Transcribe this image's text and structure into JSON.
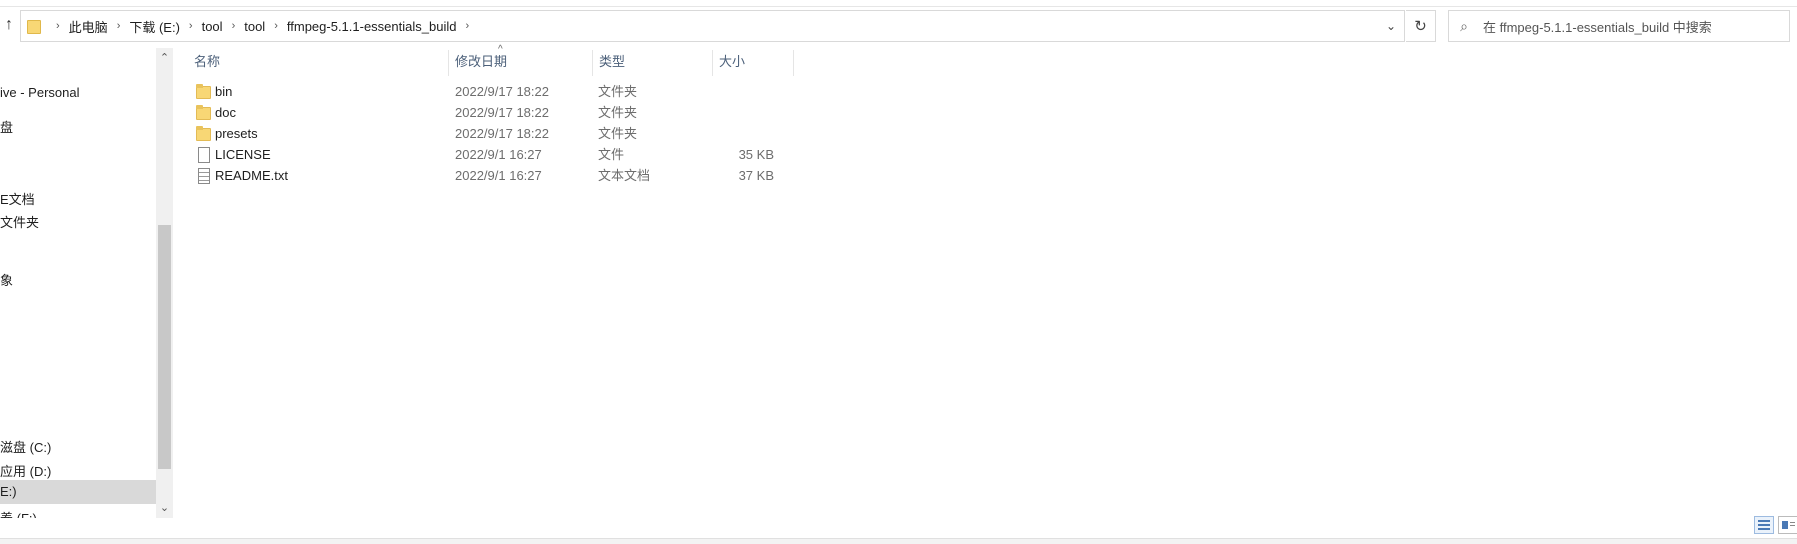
{
  "address_bar": {
    "breadcrumbs": [
      "此电脑",
      "下载 (E:)",
      "tool",
      "tool",
      "ffmpeg-5.1.1-essentials_build"
    ],
    "up_icon": "↑",
    "dropdown_icon": "⌄",
    "refresh_icon": "↻"
  },
  "search": {
    "icon": "⌕",
    "placeholder": "在 ffmpeg-5.1.1-essentials_build 中搜索"
  },
  "nav_pane": {
    "items": [
      {
        "label": "ive - Personal"
      },
      {
        "label": "盘"
      },
      {
        "label": "E文档"
      },
      {
        "label": "文件夹"
      },
      {
        "label": "象"
      },
      {
        "label": "滋盘 (C:)"
      },
      {
        "label": "应用 (D:)"
      },
      {
        "label": "E:)",
        "selected": true
      },
      {
        "label": "养 (F:)"
      }
    ],
    "scroll_up": "⌃",
    "scroll_down": "⌄"
  },
  "columns": {
    "name": "名称",
    "date": "修改日期",
    "type": "类型",
    "size": "大小",
    "sort_icon": "^"
  },
  "files": [
    {
      "name": "bin",
      "date": "2022/9/17 18:22",
      "type": "文件夹",
      "size": "",
      "icon": "folder-icon"
    },
    {
      "name": "doc",
      "date": "2022/9/17 18:22",
      "type": "文件夹",
      "size": "",
      "icon": "folder-icon"
    },
    {
      "name": "presets",
      "date": "2022/9/17 18:22",
      "type": "文件夹",
      "size": "",
      "icon": "folder-icon"
    },
    {
      "name": "LICENSE",
      "date": "2022/9/1 16:27",
      "type": "文件",
      "size": "35 KB",
      "icon": "document-icon"
    },
    {
      "name": "README.txt",
      "date": "2022/9/1 16:27",
      "type": "文本文档",
      "size": "37 KB",
      "icon": "text-file-icon"
    }
  ],
  "colors": {
    "header_text": "#4c607a",
    "selected_nav": "#d9d9d9",
    "folder": "#f8d775"
  }
}
